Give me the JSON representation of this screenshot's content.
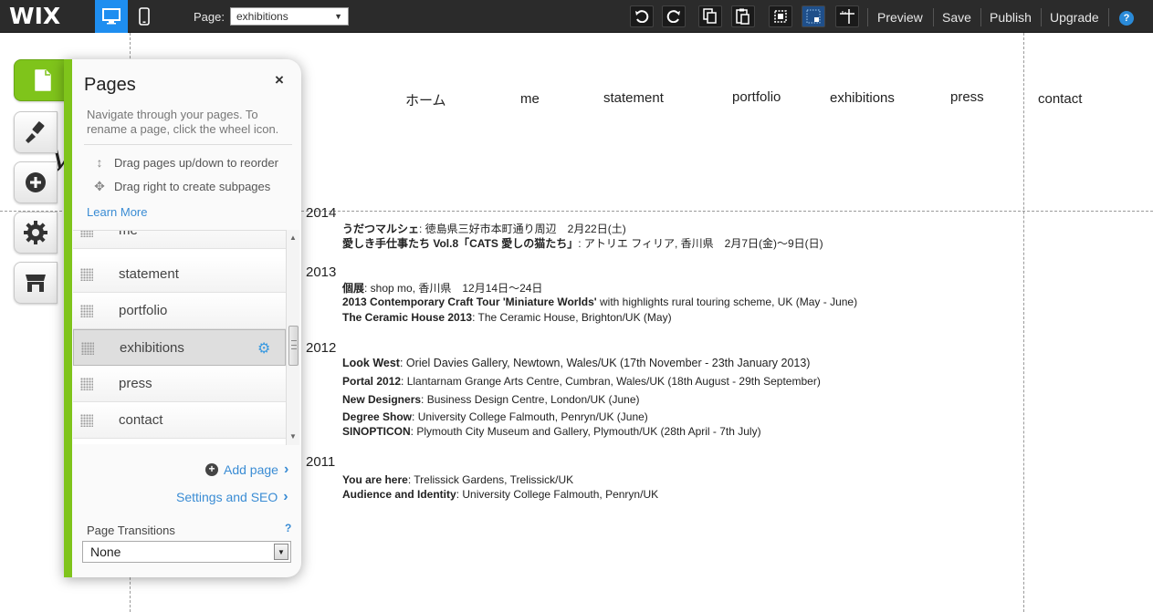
{
  "topbar": {
    "logo": "WIX",
    "page_label": "Page:",
    "page_selected": "exhibitions",
    "links": {
      "preview": "Preview",
      "save": "Save",
      "publish": "Publish",
      "upgrade": "Upgrade"
    },
    "help": "?",
    "icons": [
      "desktop-icon",
      "mobile-icon",
      "undo-icon",
      "redo-icon",
      "copy-icon",
      "paste-icon",
      "snap-icon",
      "grid-icon",
      "ruler-icon"
    ]
  },
  "site_nav": [
    "ホーム",
    "me",
    "statement",
    "portfolio",
    "exhibitions",
    "press",
    "contact"
  ],
  "exhibitions": {
    "y2014": {
      "year": "2014",
      "entries": [
        {
          "title": "うだつマルシェ",
          "detail": ": 徳島県三好市本町通り周辺　2月22日(土)"
        },
        {
          "title": "愛しき手仕事たち Vol.8「CATS 愛しの猫たち」",
          "detail": ": アトリエ フィリア, 香川県　2月7日(金)～9日(日)"
        }
      ]
    },
    "y2013": {
      "year": "2013",
      "entries": [
        {
          "title": "個展",
          "detail": ": shop mo, 香川県　12月14日～24日"
        },
        {
          "title": "2013 Contemporary Craft Tour 'Miniature Worlds'",
          "detail": " with highlights rural touring scheme, UK (May - June)"
        },
        {
          "title": "The Ceramic House 2013",
          "detail": ": The Ceramic House, Brighton/UK (May)"
        }
      ]
    },
    "y2012": {
      "year": "2012",
      "entries": [
        {
          "title": "Look West",
          "detail": ": Oriel Davies Gallery, Newtown, Wales/UK (17th November - 23th January 2013)"
        },
        {
          "title": "Portal 2012",
          "detail": ": Llantarnam Grange Arts Centre, Cumbran, Wales/UK (18th August - 29th September)"
        },
        {
          "title": "New Designers",
          "detail": ": Business Design Centre, London/UK (June)"
        },
        {
          "title": "Degree Show",
          "detail": ": University College Falmouth, Penryn/UK (June)"
        },
        {
          "title": "SINOPTICON",
          "detail": ": Plymouth City Museum and Gallery, Plymouth/UK (28th April - 7th July)"
        }
      ]
    },
    "y2011": {
      "year": "2011",
      "entries": [
        {
          "title": "You are here",
          "detail": ": Trelissick Gardens, Trelissick/UK"
        },
        {
          "title": "Audience and Identity",
          "detail": ": University College Falmouth, Penryn/UK"
        }
      ]
    }
  },
  "rail": [
    "pages-icon",
    "design-icon",
    "add-icon",
    "settings-icon",
    "app-market-icon"
  ],
  "pages_panel": {
    "title": "Pages",
    "close": "×",
    "description": "Navigate through your pages. To rename a page, click the wheel icon.",
    "hints": {
      "reorder": "Drag pages up/down to reorder",
      "subpages": "Drag right to create subpages"
    },
    "learn_more": "Learn More",
    "pages": [
      "me",
      "statement",
      "portfolio",
      "exhibitions",
      "press",
      "contact"
    ],
    "selected_page": "exhibitions",
    "add_page": "Add page",
    "settings_seo": "Settings and SEO",
    "transitions_label": "Page Transitions",
    "transitions_help": "?",
    "transitions_value": "None"
  }
}
